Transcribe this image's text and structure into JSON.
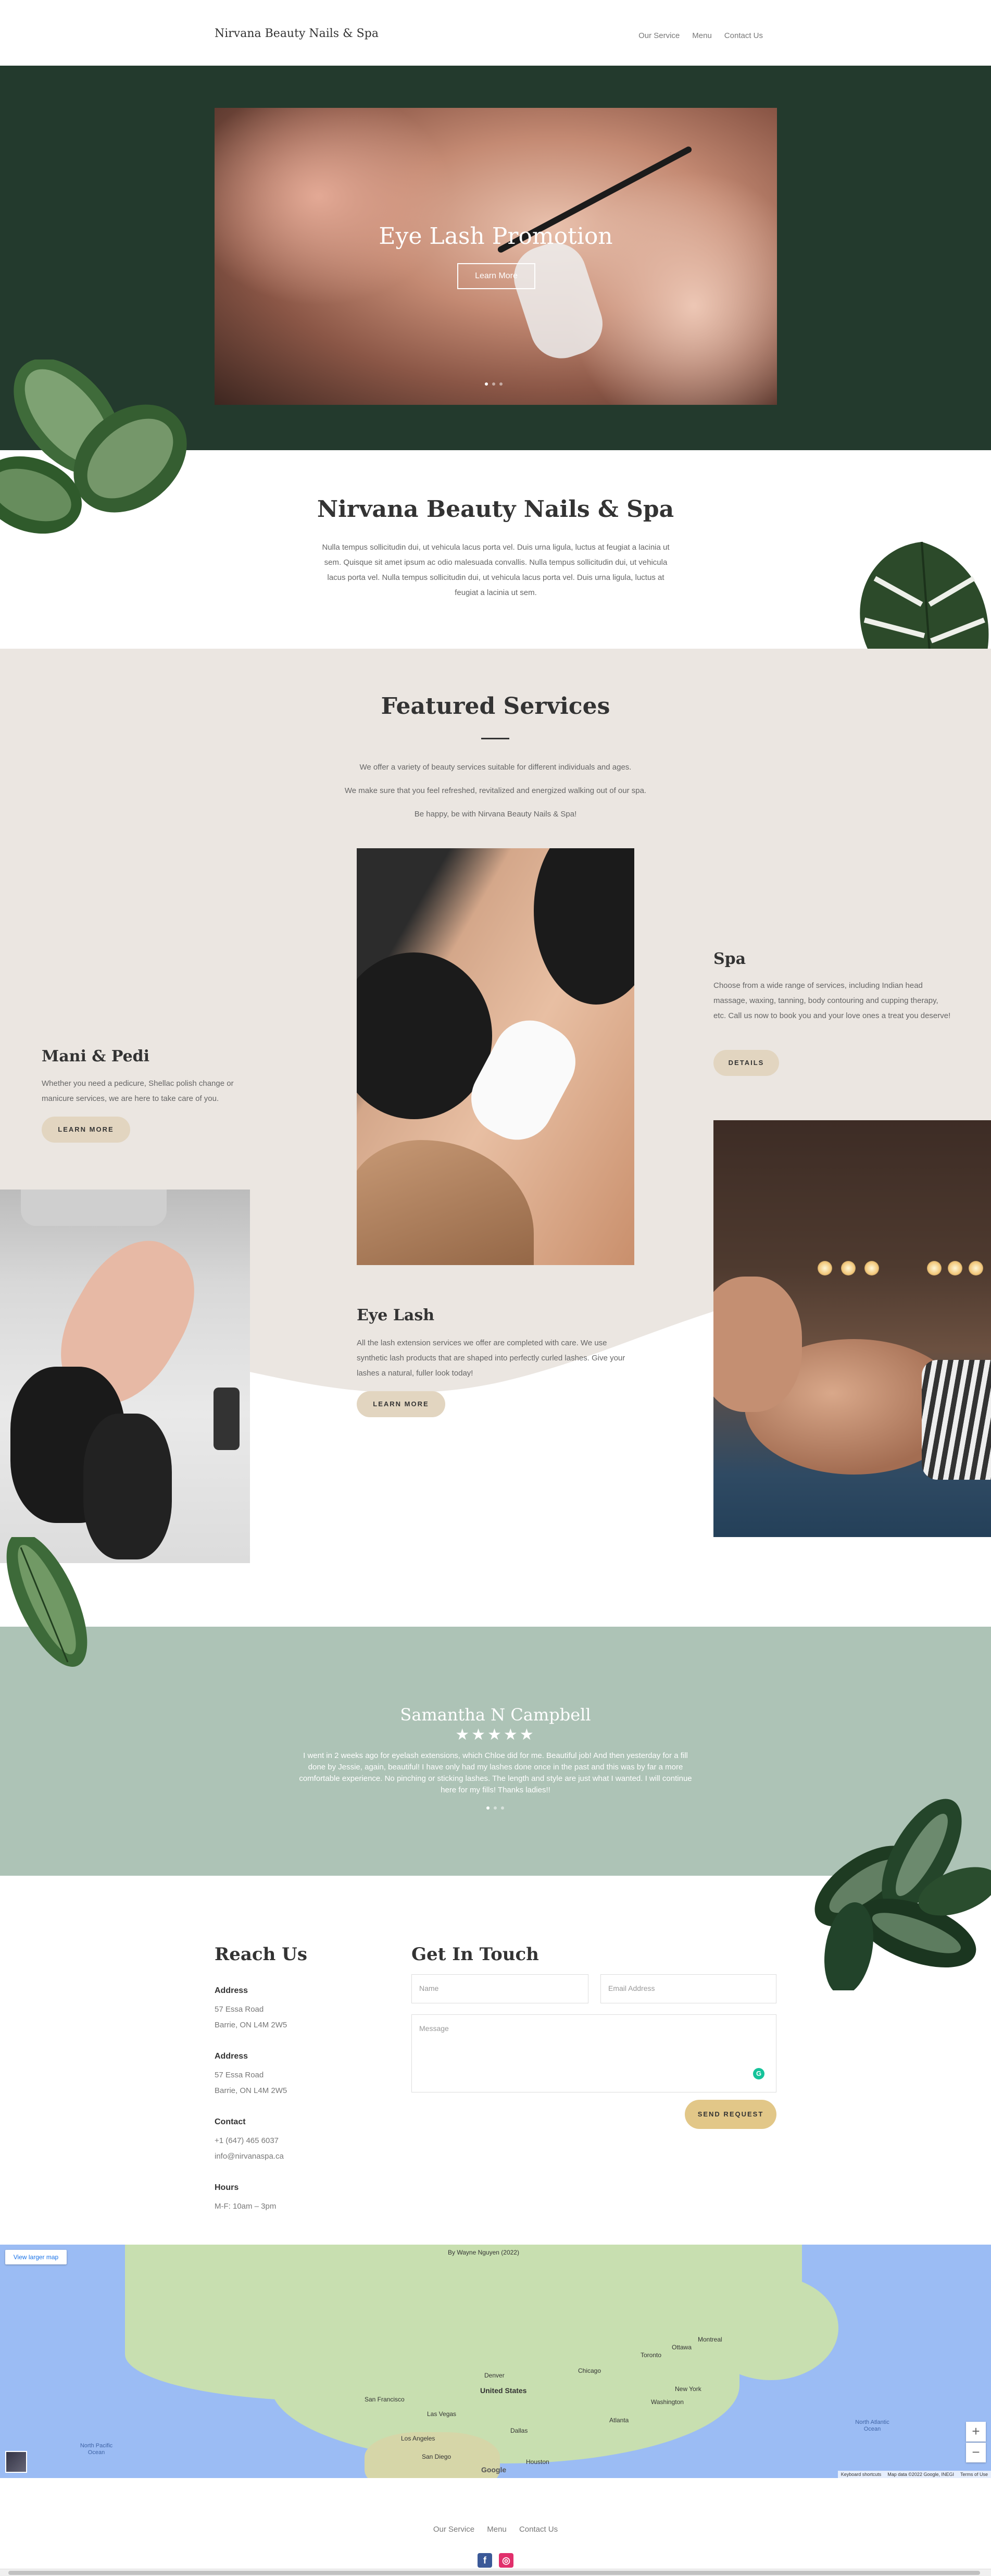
{
  "header": {
    "brand": "Nirvana Beauty Nails & Spa",
    "nav": [
      "Our Service",
      "Menu",
      "Contact Us"
    ]
  },
  "hero": {
    "title": "Eye Lash Promotion",
    "button": "Learn More",
    "slide_count": 3,
    "active_slide": 1
  },
  "intro": {
    "title": "Nirvana Beauty Nails & Spa",
    "text": "Nulla tempus sollicitudin dui, ut vehicula lacus porta vel. Duis urna ligula, luctus at feugiat a lacinia ut sem. Quisque sit amet ipsum ac odio malesuada convallis. Nulla tempus sollicitudin dui, ut vehicula lacus porta vel.  Nulla tempus sollicitudin dui, ut vehicula lacus porta vel. Duis urna ligula, luctus at feugiat a lacinia ut sem."
  },
  "featured": {
    "title": "Featured Services",
    "lines": [
      "We offer a variety of beauty services suitable for different individuals and ages.",
      "We make sure that you feel refreshed, revitalized and energized walking out of our spa.",
      "Be happy, be with Nirvana Beauty Nails & Spa!"
    ],
    "services": {
      "mani": {
        "title": "Mani & Pedi",
        "text": "Whether you need a pedicure, Shellac polish change or manicure services, we are here to take care of you.",
        "button": "LEARN MORE"
      },
      "spa": {
        "title": "Spa",
        "text": "Choose from a wide range of services, including Indian head massage, waxing, tanning, body contouring and cupping therapy, etc. Call us now to book you and your love ones a treat you deserve!",
        "button": "DETAILS"
      },
      "eyelash": {
        "title": "Eye Lash",
        "text": "All the lash extension services we offer are completed with care. We use synthetic lash products that are shaped into perfectly curled lashes. Give your lashes a natural, fuller look today!",
        "button": "LEARN MORE"
      }
    }
  },
  "testimonial": {
    "name": "Samantha N Campbell",
    "stars": "★★★★★",
    "rating": 5,
    "text": "I went in 2 weeks ago for eyelash extensions, which Chloe did for me. Beautiful job! And then yesterday for a fill done by Jessie, again, beautiful! I have only had my lashes done once in the past and this was by far a more comfortable experience. No pinching or sticking lashes. The length and style are just what I wanted. I will continue here for my fills! Thanks ladies!!",
    "slide_count": 3,
    "active_slide": 1
  },
  "reach": {
    "title": "Reach Us",
    "blocks": [
      {
        "heading": "Address",
        "lines": [
          "57 Essa Road",
          "Barrie, ON L4M 2W5"
        ]
      },
      {
        "heading": "Address",
        "lines": [
          "57 Essa Road",
          "Barrie, ON L4M 2W5"
        ]
      },
      {
        "heading": "Contact",
        "lines": [
          "+1 (647) 465 6037",
          "info@nirvanaspa.ca"
        ]
      },
      {
        "heading": "Hours",
        "lines": [
          "M-F: 10am – 3pm"
        ]
      }
    ]
  },
  "contact_form": {
    "title": "Get In Touch",
    "name_placeholder": "Name",
    "email_placeholder": "Email Address",
    "message_placeholder": "Message",
    "send": "SEND REQUEST"
  },
  "map": {
    "larger_map": "View larger map",
    "title_text": "By Wayne Nguyen (2022)",
    "country": "United States",
    "labels": [
      "Chicago",
      "New York",
      "Las Vegas",
      "Los Angeles",
      "San Francisco",
      "Denver",
      "Houston",
      "Toronto",
      "Montreal",
      "Dallas",
      "San Diego",
      "Atlanta",
      "Ottawa",
      "Washington"
    ],
    "oceans": [
      "North Pacific Ocean",
      "North Atlantic Ocean"
    ],
    "zoom_in": "+",
    "zoom_out": "−",
    "footer": [
      "Keyboard shortcuts",
      "Map data ©2022 Google, INEGI",
      "Terms of Use"
    ],
    "google": "Google",
    "colors": {
      "water": "#9bbcf4",
      "land": "#c8dfb0"
    }
  },
  "footer": {
    "nav": [
      "Our Service",
      "Menu",
      "Contact Us"
    ],
    "social": [
      {
        "icon": "facebook-icon",
        "glyph": "f",
        "color": "#3b5998"
      },
      {
        "icon": "instagram-icon",
        "glyph": "◎",
        "color": "#e1306c"
      }
    ]
  },
  "colors": {
    "hero_bg": "#233a2d",
    "featured_bg": "#ebe6e1",
    "testimonial_bg": "#adc3b6",
    "button_beige": "#e2d5c0",
    "button_gold": "#e2c788"
  }
}
